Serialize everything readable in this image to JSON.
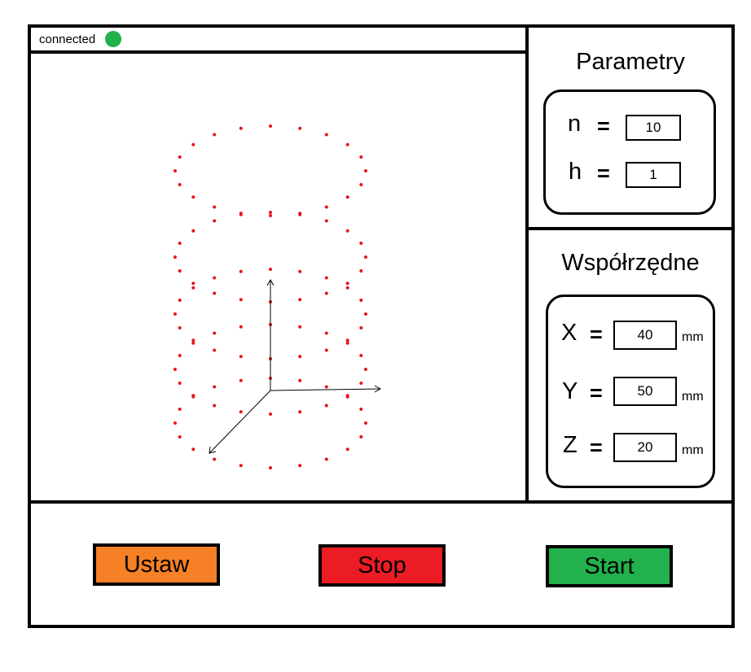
{
  "status": {
    "text": "connected",
    "indicator_color": "#1fb24a"
  },
  "parameters": {
    "title": "Parametry",
    "rows": [
      {
        "label": "n",
        "eq": "=",
        "value": "10"
      },
      {
        "label": "h",
        "eq": "=",
        "value": "1"
      }
    ]
  },
  "coordinates": {
    "title": "Współrzędne",
    "rows": [
      {
        "label": "X",
        "eq": "=",
        "value": "40",
        "unit": "mm"
      },
      {
        "label": "Y",
        "eq": "=",
        "value": "50",
        "unit": "mm"
      },
      {
        "label": "Z",
        "eq": "=",
        "value": "20",
        "unit": "mm"
      }
    ]
  },
  "buttons": {
    "set": {
      "label": "Ustaw",
      "color": "#f58025"
    },
    "stop": {
      "label": "Stop",
      "color": "#ec1c24"
    },
    "start": {
      "label": "Start",
      "color": "#22b14c"
    }
  },
  "viewport": {
    "point_color": "#e8141c",
    "point_count": 100
  }
}
